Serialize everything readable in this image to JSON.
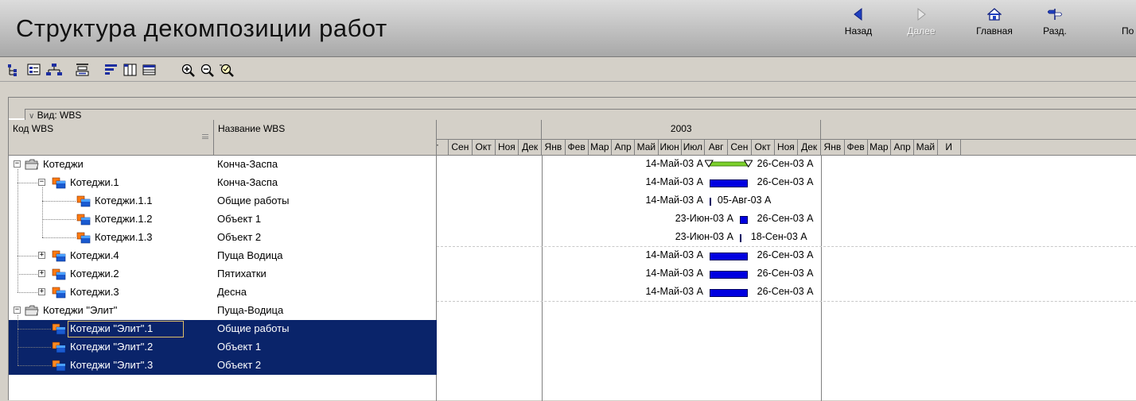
{
  "header": {
    "title": "Структура декомпозиции работ",
    "nav": {
      "back": "Назад",
      "next": "Далее",
      "home": "Главная",
      "section": "Разд.",
      "more": "По"
    }
  },
  "toolbar": {
    "icons": [
      "tree-view-icon",
      "outline-icon",
      "org-chart-icon",
      "tree-collapse-icon",
      "bar-chart-icon",
      "columns-icon",
      "table-icon",
      "zoom-in-icon",
      "zoom-out-icon",
      "zoom-fit-icon"
    ]
  },
  "view": {
    "label": "Вид: WBS"
  },
  "columns": {
    "code": "Код WBS",
    "name": "Название WBS"
  },
  "gantt": {
    "year": "2003",
    "months_prev": [
      "г",
      "Сен",
      "Окт",
      "Ноя",
      "Дек"
    ],
    "months_2003": [
      "Янв",
      "Фев",
      "Мар",
      "Апр",
      "Май",
      "Июн",
      "Июл",
      "Авг",
      "Сен",
      "Окт",
      "Ноя",
      "Дек"
    ],
    "months_next": [
      "Янв",
      "Фев",
      "Мар",
      "Апр",
      "Май",
      "И"
    ]
  },
  "rows": [
    {
      "code": "Котеджи",
      "name": "Конча-Заспа",
      "start": "14-Май-03 A",
      "finish": "26-Сен-03 A",
      "level": 0,
      "expander": "−",
      "summary": true
    },
    {
      "code": "Котеджи.1",
      "name": "Конча-Заспа",
      "start": "14-Май-03 A",
      "finish": "26-Сен-03 A",
      "level": 1,
      "expander": "−"
    },
    {
      "code": "Котеджи.1.1",
      "name": "Общие работы",
      "start": "14-Май-03 A",
      "finish": "05-Авг-03 A",
      "level": 2
    },
    {
      "code": "Котеджи.1.2",
      "name": "Объект 1",
      "start": "23-Июн-03 A",
      "finish": "26-Сен-03 A",
      "level": 2
    },
    {
      "code": "Котеджи.1.3",
      "name": "Объект 2",
      "start": "23-Июн-03 A",
      "finish": "18-Сен-03 A",
      "level": 2
    },
    {
      "code": "Котеджи.4",
      "name": "Пуща Водица",
      "start": "14-Май-03 A",
      "finish": "26-Сен-03 A",
      "level": 1,
      "expander": "+"
    },
    {
      "code": "Котеджи.2",
      "name": "Пятихатки",
      "start": "14-Май-03 A",
      "finish": "26-Сен-03 A",
      "level": 1,
      "expander": "+"
    },
    {
      "code": "Котеджи.3",
      "name": "Десна",
      "start": "14-Май-03 A",
      "finish": "26-Сен-03 A",
      "level": 1,
      "expander": "+"
    },
    {
      "code": "Котеджи \"Элит\"",
      "name": "Пуща-Водица",
      "level": 0,
      "expander": "−"
    },
    {
      "code": "Котеджи \"Элит\".1",
      "name": "Общие работы",
      "level": 1,
      "selected": true,
      "focused": true
    },
    {
      "code": "Котеджи \"Элит\".2",
      "name": "Объект 1",
      "level": 1,
      "selected": true
    },
    {
      "code": "Котеджи \"Элит\".3",
      "name": "Объект 2",
      "level": 1,
      "selected": true
    }
  ],
  "colors": {
    "selection": "#0a246a",
    "bar": "#0000e0",
    "summary_bar": "#7cd02c",
    "header_grad_top": "#dcdcdc",
    "header_grad_bottom": "#a8a8a8"
  }
}
